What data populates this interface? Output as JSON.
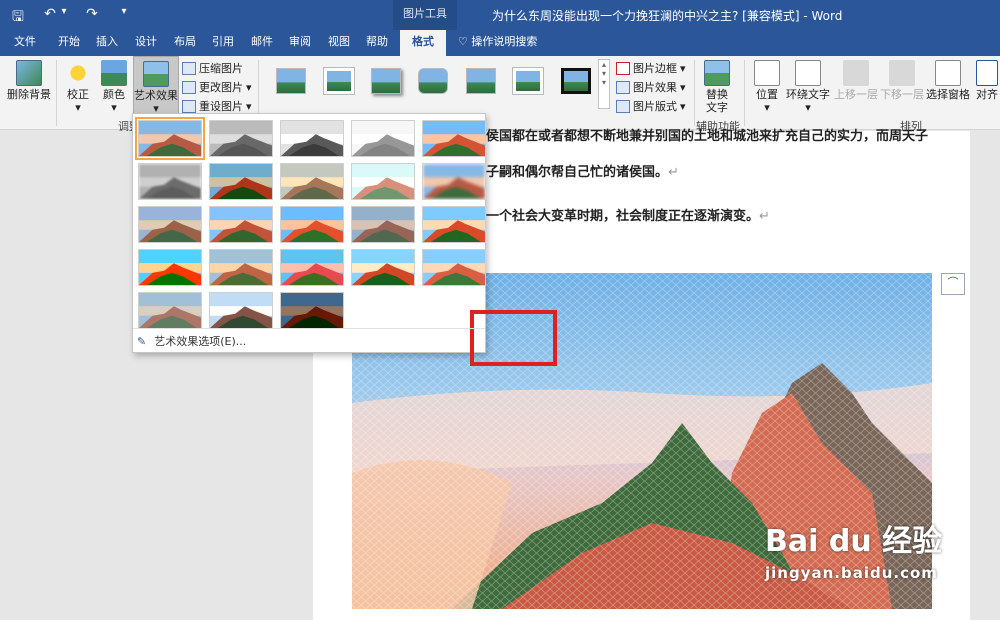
{
  "window": {
    "title": "为什么东周没能出现一个力挽狂澜的中兴之主? [兼容模式] - Word",
    "context_tab_group": "图片工具"
  },
  "quick_access": {
    "save": "🖫",
    "undo": "↶",
    "undo_dd": "▾",
    "redo": "↷",
    "customize": "▾"
  },
  "tabs": [
    "文件",
    "开始",
    "插入",
    "设计",
    "布局",
    "引用",
    "邮件",
    "审阅",
    "视图",
    "帮助",
    "格式"
  ],
  "tell_me": "操作说明搜索",
  "ribbon": {
    "remove_bg": "删除背景",
    "corrections": "校正",
    "color": "颜色",
    "artistic": "艺术效果",
    "compress": "压缩图片",
    "change": "更改图片",
    "reset": "重设图片",
    "adjust_group": "调整",
    "border": "图片边框",
    "effects": "图片效果",
    "layout": "图片版式",
    "alt_text_1": "替换",
    "alt_text_2": "文字",
    "accessibility_group": "辅助功能",
    "position": "位置",
    "wrap": "环绕文字",
    "bring_forward": "上移一层",
    "send_backward": "下移一层",
    "selection_pane": "选择窗格",
    "align": "对齐",
    "arrange_group": "排列",
    "dd_arrow": "▾"
  },
  "document": {
    "line1": "侯国都在或者都想不断地兼并别国的土地和城池来扩充自己的实力，而周天子",
    "line2": "子嗣和偶尔帮自己忙的诸侯国。",
    "line3": "一个社会大变革时期，社会制度正在逐渐演变。",
    "para_mark": "↵"
  },
  "dropdown": {
    "options_label": "艺术效果选项(E)...",
    "rows": 5,
    "cols": 5,
    "count": 23,
    "selected_index": 0,
    "highlighted_index": 13
  },
  "watermark": {
    "brand": "Bai du 经验",
    "url": "jingyan.baidu.com"
  },
  "colors": {
    "accent": "#2b579a",
    "highlight": "#e02020",
    "selected": "#f4a742"
  }
}
